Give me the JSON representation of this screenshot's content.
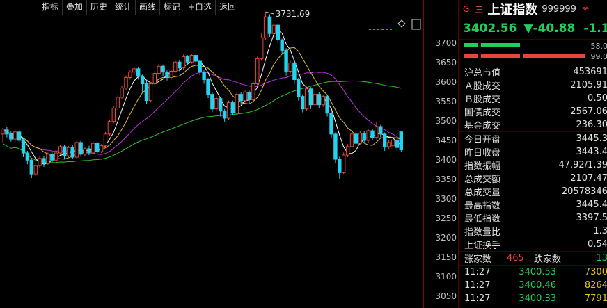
{
  "toolbar": [
    "指标",
    "叠加",
    "历史",
    "统计",
    "画线",
    "标记",
    "+自选",
    "返回"
  ],
  "chart": {
    "max_label": "3731.69",
    "y_ticks": [
      "3700",
      "3650",
      "3600",
      "3550",
      "3500",
      "3450",
      "3400",
      "3350",
      "3300",
      "3250",
      "3200",
      "3150",
      "3100",
      "3050"
    ],
    "colors": {
      "up": "#e8463a",
      "down": "#22d4f0",
      "ma5": "#ffffff",
      "ma10": "#e0c020",
      "ma20": "#c030e0",
      "ma60": "#2ec02e",
      "bg": "#000000"
    }
  },
  "chart_data": {
    "type": "candlestick",
    "ylim": [
      3025,
      3760
    ],
    "candles": [
      [
        3440,
        3452,
        3420,
        3455
      ],
      [
        3450,
        3440,
        3432,
        3458
      ],
      [
        3440,
        3428,
        3422,
        3446
      ],
      [
        3428,
        3445,
        3420,
        3450
      ],
      [
        3445,
        3425,
        3418,
        3452
      ],
      [
        3425,
        3395,
        3385,
        3430
      ],
      [
        3395,
        3378,
        3368,
        3400
      ],
      [
        3378,
        3345,
        3335,
        3382
      ],
      [
        3345,
        3365,
        3340,
        3370
      ],
      [
        3365,
        3382,
        3360,
        3388
      ],
      [
        3382,
        3370,
        3362,
        3388
      ],
      [
        3370,
        3392,
        3366,
        3396
      ],
      [
        3392,
        3378,
        3372,
        3398
      ],
      [
        3378,
        3395,
        3372,
        3400
      ],
      [
        3395,
        3410,
        3390,
        3415
      ],
      [
        3410,
        3388,
        3380,
        3414
      ],
      [
        3388,
        3408,
        3384,
        3412
      ],
      [
        3408,
        3385,
        3380,
        3414
      ],
      [
        3385,
        3420,
        3382,
        3424
      ],
      [
        3420,
        3392,
        3386,
        3424
      ],
      [
        3392,
        3405,
        3386,
        3410
      ],
      [
        3405,
        3395,
        3390,
        3412
      ],
      [
        3395,
        3418,
        3392,
        3422
      ],
      [
        3418,
        3398,
        3392,
        3422
      ],
      [
        3398,
        3412,
        3395,
        3416
      ],
      [
        3412,
        3440,
        3408,
        3445
      ],
      [
        3440,
        3470,
        3436,
        3475
      ],
      [
        3470,
        3502,
        3466,
        3506
      ],
      [
        3502,
        3528,
        3498,
        3532
      ],
      [
        3528,
        3550,
        3524,
        3556
      ],
      [
        3550,
        3575,
        3546,
        3580
      ],
      [
        3575,
        3588,
        3570,
        3594
      ],
      [
        3588,
        3596,
        3582,
        3600
      ],
      [
        3596,
        3578,
        3570,
        3600
      ],
      [
        3578,
        3560,
        3540,
        3582
      ],
      [
        3560,
        3520,
        3512,
        3566
      ],
      [
        3520,
        3560,
        3516,
        3564
      ],
      [
        3560,
        3585,
        3556,
        3590
      ],
      [
        3585,
        3602,
        3580,
        3608
      ],
      [
        3602,
        3588,
        3578,
        3606
      ],
      [
        3588,
        3575,
        3568,
        3592
      ],
      [
        3575,
        3590,
        3570,
        3594
      ],
      [
        3590,
        3612,
        3586,
        3616
      ],
      [
        3612,
        3598,
        3590,
        3616
      ],
      [
        3598,
        3625,
        3594,
        3630
      ],
      [
        3625,
        3612,
        3605,
        3628
      ],
      [
        3612,
        3628,
        3608,
        3632
      ],
      [
        3628,
        3614,
        3606,
        3630
      ],
      [
        3614,
        3588,
        3580,
        3618
      ],
      [
        3588,
        3570,
        3560,
        3592
      ],
      [
        3570,
        3535,
        3526,
        3574
      ],
      [
        3535,
        3500,
        3492,
        3540
      ],
      [
        3500,
        3525,
        3496,
        3530
      ],
      [
        3525,
        3495,
        3482,
        3528
      ],
      [
        3495,
        3478,
        3470,
        3500
      ],
      [
        3478,
        3515,
        3474,
        3520
      ],
      [
        3515,
        3490,
        3485,
        3520
      ],
      [
        3490,
        3535,
        3486,
        3540
      ],
      [
        3535,
        3520,
        3510,
        3540
      ],
      [
        3520,
        3540,
        3515,
        3544
      ],
      [
        3540,
        3522,
        3512,
        3544
      ],
      [
        3522,
        3560,
        3518,
        3565
      ],
      [
        3560,
        3620,
        3555,
        3625
      ],
      [
        3620,
        3670,
        3615,
        3680
      ],
      [
        3670,
        3720,
        3665,
        3731.69
      ],
      [
        3720,
        3680,
        3672,
        3726
      ],
      [
        3680,
        3700,
        3675,
        3710
      ],
      [
        3700,
        3665,
        3658,
        3704
      ],
      [
        3665,
        3640,
        3630,
        3668
      ],
      [
        3640,
        3590,
        3580,
        3645
      ],
      [
        3590,
        3610,
        3585,
        3615
      ],
      [
        3610,
        3570,
        3560,
        3614
      ],
      [
        3570,
        3530,
        3520,
        3574
      ],
      [
        3530,
        3500,
        3492,
        3535
      ],
      [
        3500,
        3548,
        3496,
        3552
      ],
      [
        3548,
        3510,
        3500,
        3552
      ],
      [
        3510,
        3535,
        3505,
        3540
      ],
      [
        3535,
        3510,
        3502,
        3540
      ],
      [
        3510,
        3530,
        3505,
        3534
      ],
      [
        3530,
        3490,
        3482,
        3534
      ],
      [
        3490,
        3440,
        3430,
        3494
      ],
      [
        3440,
        3380,
        3370,
        3444
      ],
      [
        3380,
        3348,
        3332,
        3386
      ],
      [
        3348,
        3390,
        3345,
        3396
      ],
      [
        3390,
        3410,
        3385,
        3416
      ],
      [
        3410,
        3440,
        3405,
        3445
      ],
      [
        3440,
        3418,
        3410,
        3445
      ],
      [
        3418,
        3442,
        3414,
        3448
      ],
      [
        3442,
        3425,
        3418,
        3448
      ],
      [
        3425,
        3448,
        3420,
        3452
      ],
      [
        3448,
        3432,
        3425,
        3452
      ],
      [
        3432,
        3458,
        3428,
        3470
      ],
      [
        3458,
        3440,
        3432,
        3462
      ],
      [
        3440,
        3410,
        3400,
        3444
      ],
      [
        3410,
        3420,
        3405,
        3425
      ],
      [
        3412,
        3426,
        3408,
        3428
      ],
      [
        3426,
        3408,
        3400,
        3432
      ],
      [
        3445.3,
        3402.56,
        3397.5,
        3445.4
      ]
    ]
  },
  "panel": {
    "g_label": "G",
    "e_label": "三",
    "name": "上证指数",
    "code": "999999",
    "tag": "se",
    "price": "3402.56",
    "change": "▼-40.88",
    "change_pct": "-1.19",
    "bar1_pct": "58.0",
    "bar2_pct": "99.0",
    "rows1": [
      {
        "label": "沪总市值",
        "value": "453691"
      },
      {
        "label": "Ａ股成交",
        "value": "2105.91"
      },
      {
        "label": "Ｂ股成交",
        "value": "0.50"
      },
      {
        "label": "国债成交",
        "value": "2567.06"
      },
      {
        "label": "基金成交",
        "value": "236.30"
      }
    ],
    "rows2": [
      {
        "label": "今日开盘",
        "value": "3445.3"
      },
      {
        "label": "昨日收盘",
        "value": "3443.4"
      },
      {
        "label": "指数振幅",
        "value": "47.92/1.39"
      },
      {
        "label": "总成交额",
        "value": "2107.47"
      },
      {
        "label": "总成交量",
        "value": "20578346"
      },
      {
        "label": "最高指数",
        "value": "3445.4"
      },
      {
        "label": "最低指数",
        "value": "3397.5"
      },
      {
        "label": "指数量比",
        "value": "1.3"
      },
      {
        "label": "上证换手",
        "value": "0.54"
      }
    ],
    "breadth": {
      "up_label": "涨家数",
      "up_value": "465",
      "down_label": "跌家数",
      "down_value": "13"
    },
    "ticks": [
      {
        "time": "11:27",
        "price": "3400.53",
        "vol": "7300"
      },
      {
        "time": "11:27",
        "price": "3400.46",
        "vol": "8264"
      },
      {
        "time": "11:27",
        "price": "3400.33",
        "vol": "7791"
      }
    ]
  }
}
